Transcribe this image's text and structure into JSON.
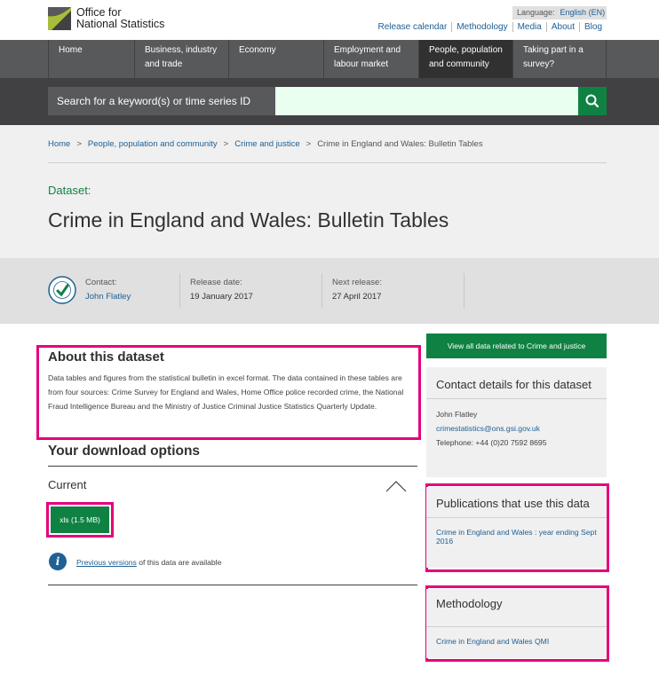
{
  "header": {
    "logo_line1": "Office for",
    "logo_line2": "National Statistics",
    "language_label": "Language:",
    "language_value": "English (EN)",
    "links": [
      "Release calendar",
      "Methodology",
      "Media",
      "About",
      "Blog"
    ]
  },
  "nav": {
    "items": [
      {
        "line1": "Home",
        "line2": ""
      },
      {
        "line1": "Business, industry",
        "line2": "and trade"
      },
      {
        "line1": "Economy",
        "line2": ""
      },
      {
        "line1": "Employment and",
        "line2": "labour market"
      },
      {
        "line1": "People, population",
        "line2": "and community"
      },
      {
        "line1": "Taking part in a",
        "line2": "survey?"
      }
    ]
  },
  "search": {
    "label": "Search for a keyword(s) or time series ID",
    "value": ""
  },
  "breadcrumb": {
    "items": [
      "Home",
      "People, population and community",
      "Crime and justice"
    ],
    "current": "Crime in England and Wales: Bulletin Tables",
    "separator": ">"
  },
  "page": {
    "type_label": "Dataset:",
    "title": "Crime in England and Wales: Bulletin Tables"
  },
  "meta": {
    "contact_label": "Contact:",
    "contact_name": "John Flatley",
    "release_label": "Release date:",
    "release_value": "19 January 2017",
    "next_label": "Next release:",
    "next_value": "27 April 2017"
  },
  "about": {
    "title": "About this dataset",
    "body": "Data tables and figures from the statistical bulletin in excel format. The data contained in these tables are from four sources: Crime Survey for England and Wales, Home Office police recorded crime, the National Fraud Intelligence Bureau and the Ministry of Justice Criminal Justice Statistics Quarterly Update."
  },
  "downloads": {
    "title": "Your download options",
    "current_label": "Current",
    "xls_label": "xls (1.5 MB)",
    "previous_link": "Previous versions",
    "previous_suffix": " of this data are available"
  },
  "sidebar": {
    "view_all_button": "View all data related to Crime and justice",
    "contact_title": "Contact details for this dataset",
    "contact_name": "John Flatley",
    "contact_email": "crimestatistics@ons.gsi.gov.uk",
    "contact_phone": "Telephone: +44 (0)20 7592 8695",
    "publications_title": "Publications that use this data",
    "publications_link": "Crime in England and Wales : year ending Sept 2016",
    "methodology_title": "Methodology",
    "methodology_link": "Crime in England and Wales QMI"
  },
  "colors": {
    "accent_green": "#0f8243",
    "link_blue": "#206095",
    "highlight_pink": "#e5007e",
    "nav_dark": "#58595b"
  },
  "icons": [
    "ons-logo-icon",
    "search-icon",
    "national-statistics-icon",
    "chevron-up-icon",
    "info-icon"
  ]
}
